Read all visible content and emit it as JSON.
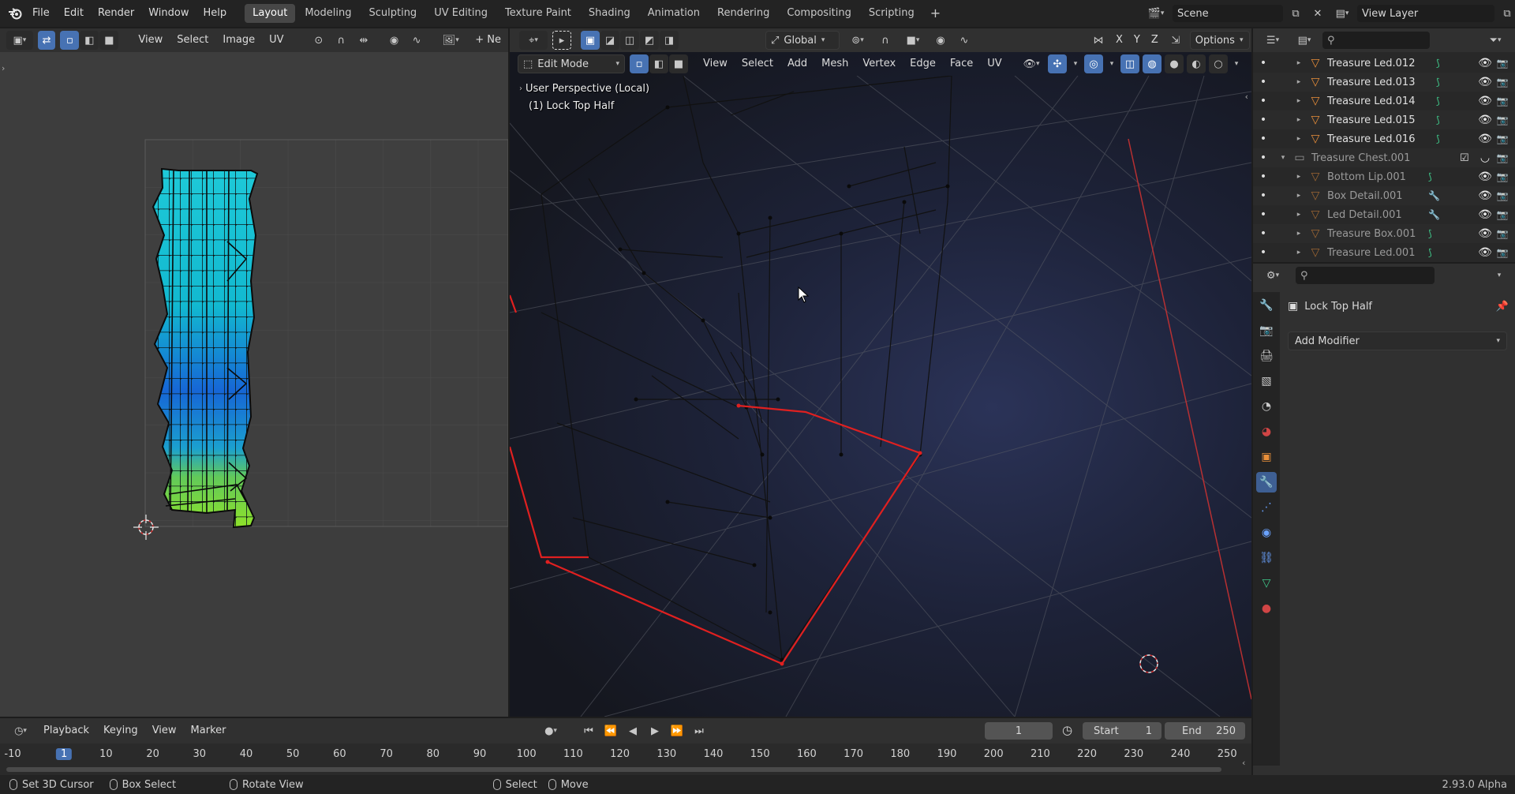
{
  "topbar": {
    "menus": [
      "File",
      "Edit",
      "Render",
      "Window",
      "Help"
    ],
    "workspaces": [
      "Layout",
      "Modeling",
      "Sculpting",
      "UV Editing",
      "Texture Paint",
      "Shading",
      "Animation",
      "Rendering",
      "Compositing",
      "Scripting"
    ],
    "active_workspace": "Layout",
    "add_tab": "+",
    "scene_name": "Scene",
    "view_layer_name": "View Layer"
  },
  "uv_editor": {
    "menus": [
      "View",
      "Select",
      "Image",
      "UV"
    ],
    "new_label": "+ Ne"
  },
  "viewport": {
    "mode": "Edit Mode",
    "menus": [
      "View",
      "Select",
      "Add",
      "Mesh",
      "Vertex",
      "Edge",
      "Face",
      "UV"
    ],
    "orientation": "Global",
    "options_label": "Options",
    "axes": [
      "X",
      "Y",
      "Z"
    ],
    "overlay_title": "User Perspective (Local)",
    "overlay_object": "(1) Lock Top Half"
  },
  "outliner": {
    "search_placeholder": "",
    "rows": [
      {
        "name": "Treasure Led.012",
        "level": 2,
        "dim": false
      },
      {
        "name": "Treasure Led.013",
        "level": 2,
        "dim": false
      },
      {
        "name": "Treasure Led.014",
        "level": 2,
        "dim": false
      },
      {
        "name": "Treasure Led.015",
        "level": 2,
        "dim": false
      },
      {
        "name": "Treasure Led.016",
        "level": 2,
        "dim": false
      },
      {
        "name": "Treasure Chest.001",
        "level": 1,
        "dim": true,
        "collection": true
      },
      {
        "name": "Bottom Lip.001",
        "level": 2,
        "dim": true
      },
      {
        "name": "Box Detail.001",
        "level": 2,
        "dim": true
      },
      {
        "name": "Led Detail.001",
        "level": 2,
        "dim": true
      },
      {
        "name": "Treasure Box.001",
        "level": 2,
        "dim": true
      },
      {
        "name": "Treasure Led.001",
        "level": 2,
        "dim": true
      }
    ]
  },
  "properties": {
    "object_name": "Lock Top Half",
    "add_modifier": "Add Modifier"
  },
  "timeline": {
    "menus": [
      "Playback",
      "Keying",
      "View",
      "Marker"
    ],
    "current_frame": "1",
    "start_label": "Start",
    "start_value": "1",
    "end_label": "End",
    "end_value": "250",
    "ticks": [
      "-10",
      "1",
      "10",
      "20",
      "30",
      "40",
      "50",
      "60",
      "70",
      "80",
      "90",
      "100",
      "110",
      "120",
      "130",
      "140",
      "150",
      "160",
      "170",
      "180",
      "190",
      "200",
      "210",
      "220",
      "230",
      "240",
      "250"
    ]
  },
  "statusbar": {
    "set_cursor": "Set 3D Cursor",
    "box_select": "Box Select",
    "rotate_view": "Rotate View",
    "select": "Select",
    "move": "Move",
    "version": "2.93.0 Alpha"
  },
  "colors": {
    "accent": "#4772b3",
    "selected_edge": "#e02020",
    "object_orange": "#e98f3a"
  }
}
